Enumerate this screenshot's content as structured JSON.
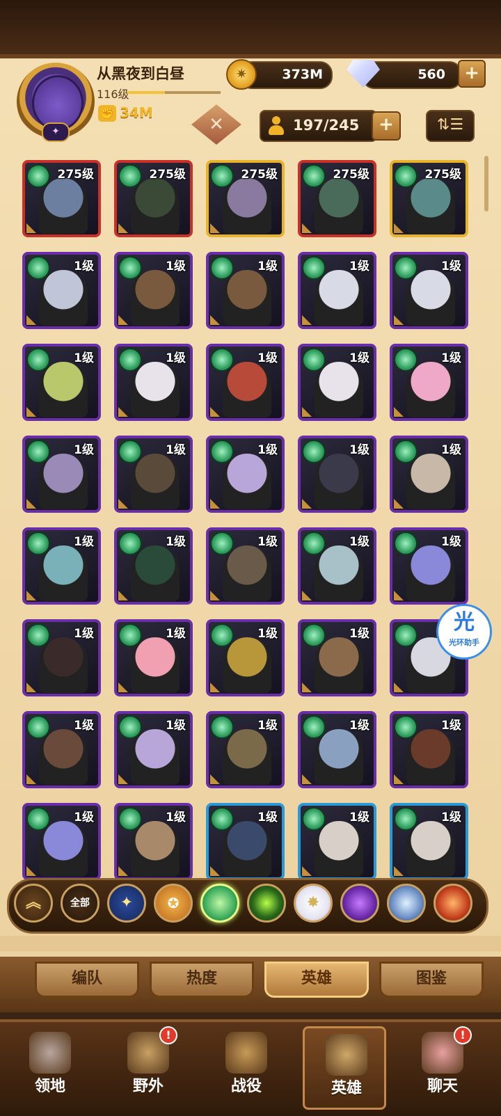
{
  "player": {
    "name": "从黑夜到白昼",
    "level": "116级",
    "xp_fraction": 0.4,
    "power": "34M"
  },
  "resources": {
    "gold": "373M",
    "diamonds": "560",
    "plus": "+"
  },
  "heroes_count": "197/245",
  "colors": {
    "panel": "#f0d9a8",
    "celestial_border": "#e6b32a",
    "legendary_plus_border": "#c8302a",
    "elite_border": "#6a2fa8",
    "rare_border": "#2a9ad6"
  },
  "heroes": [
    {
      "level": "275级",
      "rarity": "red"
    },
    {
      "level": "275级",
      "rarity": "red"
    },
    {
      "level": "275级",
      "rarity": "gold"
    },
    {
      "level": "275级",
      "rarity": "red"
    },
    {
      "level": "275级",
      "rarity": "gold"
    },
    {
      "level": "1级",
      "rarity": "purple"
    },
    {
      "level": "1级",
      "rarity": "purple"
    },
    {
      "level": "1级",
      "rarity": "purple"
    },
    {
      "level": "1级",
      "rarity": "purple"
    },
    {
      "level": "1级",
      "rarity": "purple"
    },
    {
      "level": "1级",
      "rarity": "purple"
    },
    {
      "level": "1级",
      "rarity": "purple"
    },
    {
      "level": "1级",
      "rarity": "purple"
    },
    {
      "level": "1级",
      "rarity": "purple"
    },
    {
      "level": "1级",
      "rarity": "purple"
    },
    {
      "level": "1级",
      "rarity": "purple"
    },
    {
      "level": "1级",
      "rarity": "purple"
    },
    {
      "level": "1级",
      "rarity": "purple"
    },
    {
      "level": "1级",
      "rarity": "purple"
    },
    {
      "level": "1级",
      "rarity": "purple"
    },
    {
      "level": "1级",
      "rarity": "purple"
    },
    {
      "level": "1级",
      "rarity": "purple"
    },
    {
      "level": "1级",
      "rarity": "purple"
    },
    {
      "level": "1级",
      "rarity": "purple"
    },
    {
      "level": "1级",
      "rarity": "purple"
    },
    {
      "level": "1级",
      "rarity": "purple"
    },
    {
      "level": "1级",
      "rarity": "purple"
    },
    {
      "level": "1级",
      "rarity": "purple"
    },
    {
      "level": "1级",
      "rarity": "purple"
    },
    {
      "level": "1级",
      "rarity": "purple"
    },
    {
      "level": "1级",
      "rarity": "purple"
    },
    {
      "level": "1级",
      "rarity": "purple"
    },
    {
      "level": "1级",
      "rarity": "purple"
    },
    {
      "level": "1级",
      "rarity": "purple"
    },
    {
      "level": "1级",
      "rarity": "purple"
    },
    {
      "level": "1级",
      "rarity": "purple"
    },
    {
      "level": "1级",
      "rarity": "purple"
    },
    {
      "level": "1级",
      "rarity": "blue"
    },
    {
      "level": "1级",
      "rarity": "blue"
    },
    {
      "level": "1级",
      "rarity": "blue"
    }
  ],
  "filters": [
    {
      "name": "collapse-filter-button",
      "label": "",
      "icon": "chevron-up-icon"
    },
    {
      "name": "filter-all-button",
      "label": "全部",
      "icon": ""
    },
    {
      "name": "filter-lightbearer-button",
      "label": "",
      "icon": "star-icon"
    },
    {
      "name": "filter-mauler-button",
      "label": "",
      "icon": "mauler-icon"
    },
    {
      "name": "filter-wilder-button",
      "label": "",
      "icon": "leaf-icon",
      "active": true
    },
    {
      "name": "filter-graveborn-button",
      "label": "",
      "icon": "eye-icon"
    },
    {
      "name": "filter-celestial-button",
      "label": "",
      "icon": "sun-icon"
    },
    {
      "name": "filter-hypogean-button",
      "label": "",
      "icon": "diamond-icon"
    },
    {
      "name": "filter-dimensional-button",
      "label": "",
      "icon": "dimensional-icon"
    },
    {
      "name": "filter-dragon-button",
      "label": "",
      "icon": "dragon-icon"
    }
  ],
  "subtabs": [
    {
      "label": "编队",
      "active": false
    },
    {
      "label": "热度",
      "active": false
    },
    {
      "label": "英雄",
      "active": true
    },
    {
      "label": "图鉴",
      "active": false
    }
  ],
  "nav": [
    {
      "label": "领地",
      "badge": ""
    },
    {
      "label": "野外",
      "badge": "!"
    },
    {
      "label": "战役",
      "badge": ""
    },
    {
      "label": "英雄",
      "badge": "",
      "active": true
    },
    {
      "label": "聊天",
      "badge": "!"
    }
  ],
  "assistant": {
    "glyph": "光",
    "label": "光环助手"
  }
}
